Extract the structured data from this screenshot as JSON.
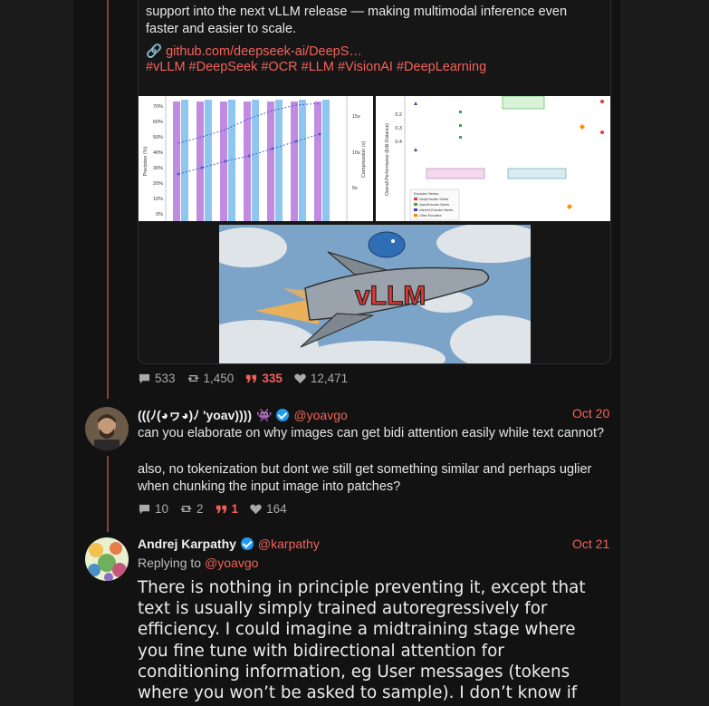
{
  "quoted_post": {
    "text": "support into the next vLLM release — making multimodal inference even faster and easier to scale.",
    "link_icon": "🔗",
    "link": "github.com/deepseek-ai/DeepS…",
    "hashtags": "#vLLM #DeepSeek #OCR #LLM #VisionAI #DeepLearning",
    "images": [
      {
        "label": "precision-compression-chart",
        "ylabel": "Precision (%)",
        "y2label": "Compression (x)",
        "yticks": [
          "70%",
          "60%",
          "50%",
          "40%",
          "30%",
          "20%",
          "10%",
          "0%"
        ],
        "y2ticks": [
          "15x",
          "10x",
          "5x"
        ]
      },
      {
        "label": "ocr-performance-chart",
        "ylabel": "Overall Performance (Edit Distance)",
        "yticks": [
          "0.2",
          "0.3",
          "0.4"
        ],
        "legend_title": "Encoder Series",
        "legend": [
          "DeepEncoder Series",
          "QwenEncoder Series",
          "InternVLEncoder Series",
          "Other Encoders"
        ]
      },
      {
        "label": "vllm-rocket-illustration",
        "text": "vLLM"
      }
    ]
  },
  "quoted_stats": {
    "replies": "533",
    "reposts": "1,450",
    "quotes": "335",
    "likes": "12,471"
  },
  "reply1": {
    "name": "(((ﾉ(◕ヮ◕)ﾉ 'yoav))))",
    "emoji": "👾",
    "handle": "@yoavgo",
    "date": "Oct 20",
    "text1": "can you elaborate on why images can get bidi attention easily while text cannot?",
    "text2": "also, no tokenization but dont we still get something similar and perhaps uglier when chunking the input image into patches?",
    "stats": {
      "replies": "10",
      "reposts": "2",
      "quotes": "1",
      "likes": "164"
    }
  },
  "reply2": {
    "name": "Andrej Karpathy",
    "handle": "@karpathy",
    "date": "Oct 21",
    "replying_label": "Replying to",
    "replying_to": "@yoavgo",
    "text": "There is nothing in principle preventing it, except that text is usually simply trained autoregressively for efficiency. I could imagine a midtraining stage where you fine tune with bidirectional attention for conditioning information, eg User messages (tokens where you won’t be asked to sample). I don’t know if this is done in practice. I mean, if you want to be"
  },
  "colors": {
    "accent": "#f4615a",
    "thread_line": "#8f3c3c",
    "verified": "#1d9bf0",
    "background": "#121212"
  }
}
